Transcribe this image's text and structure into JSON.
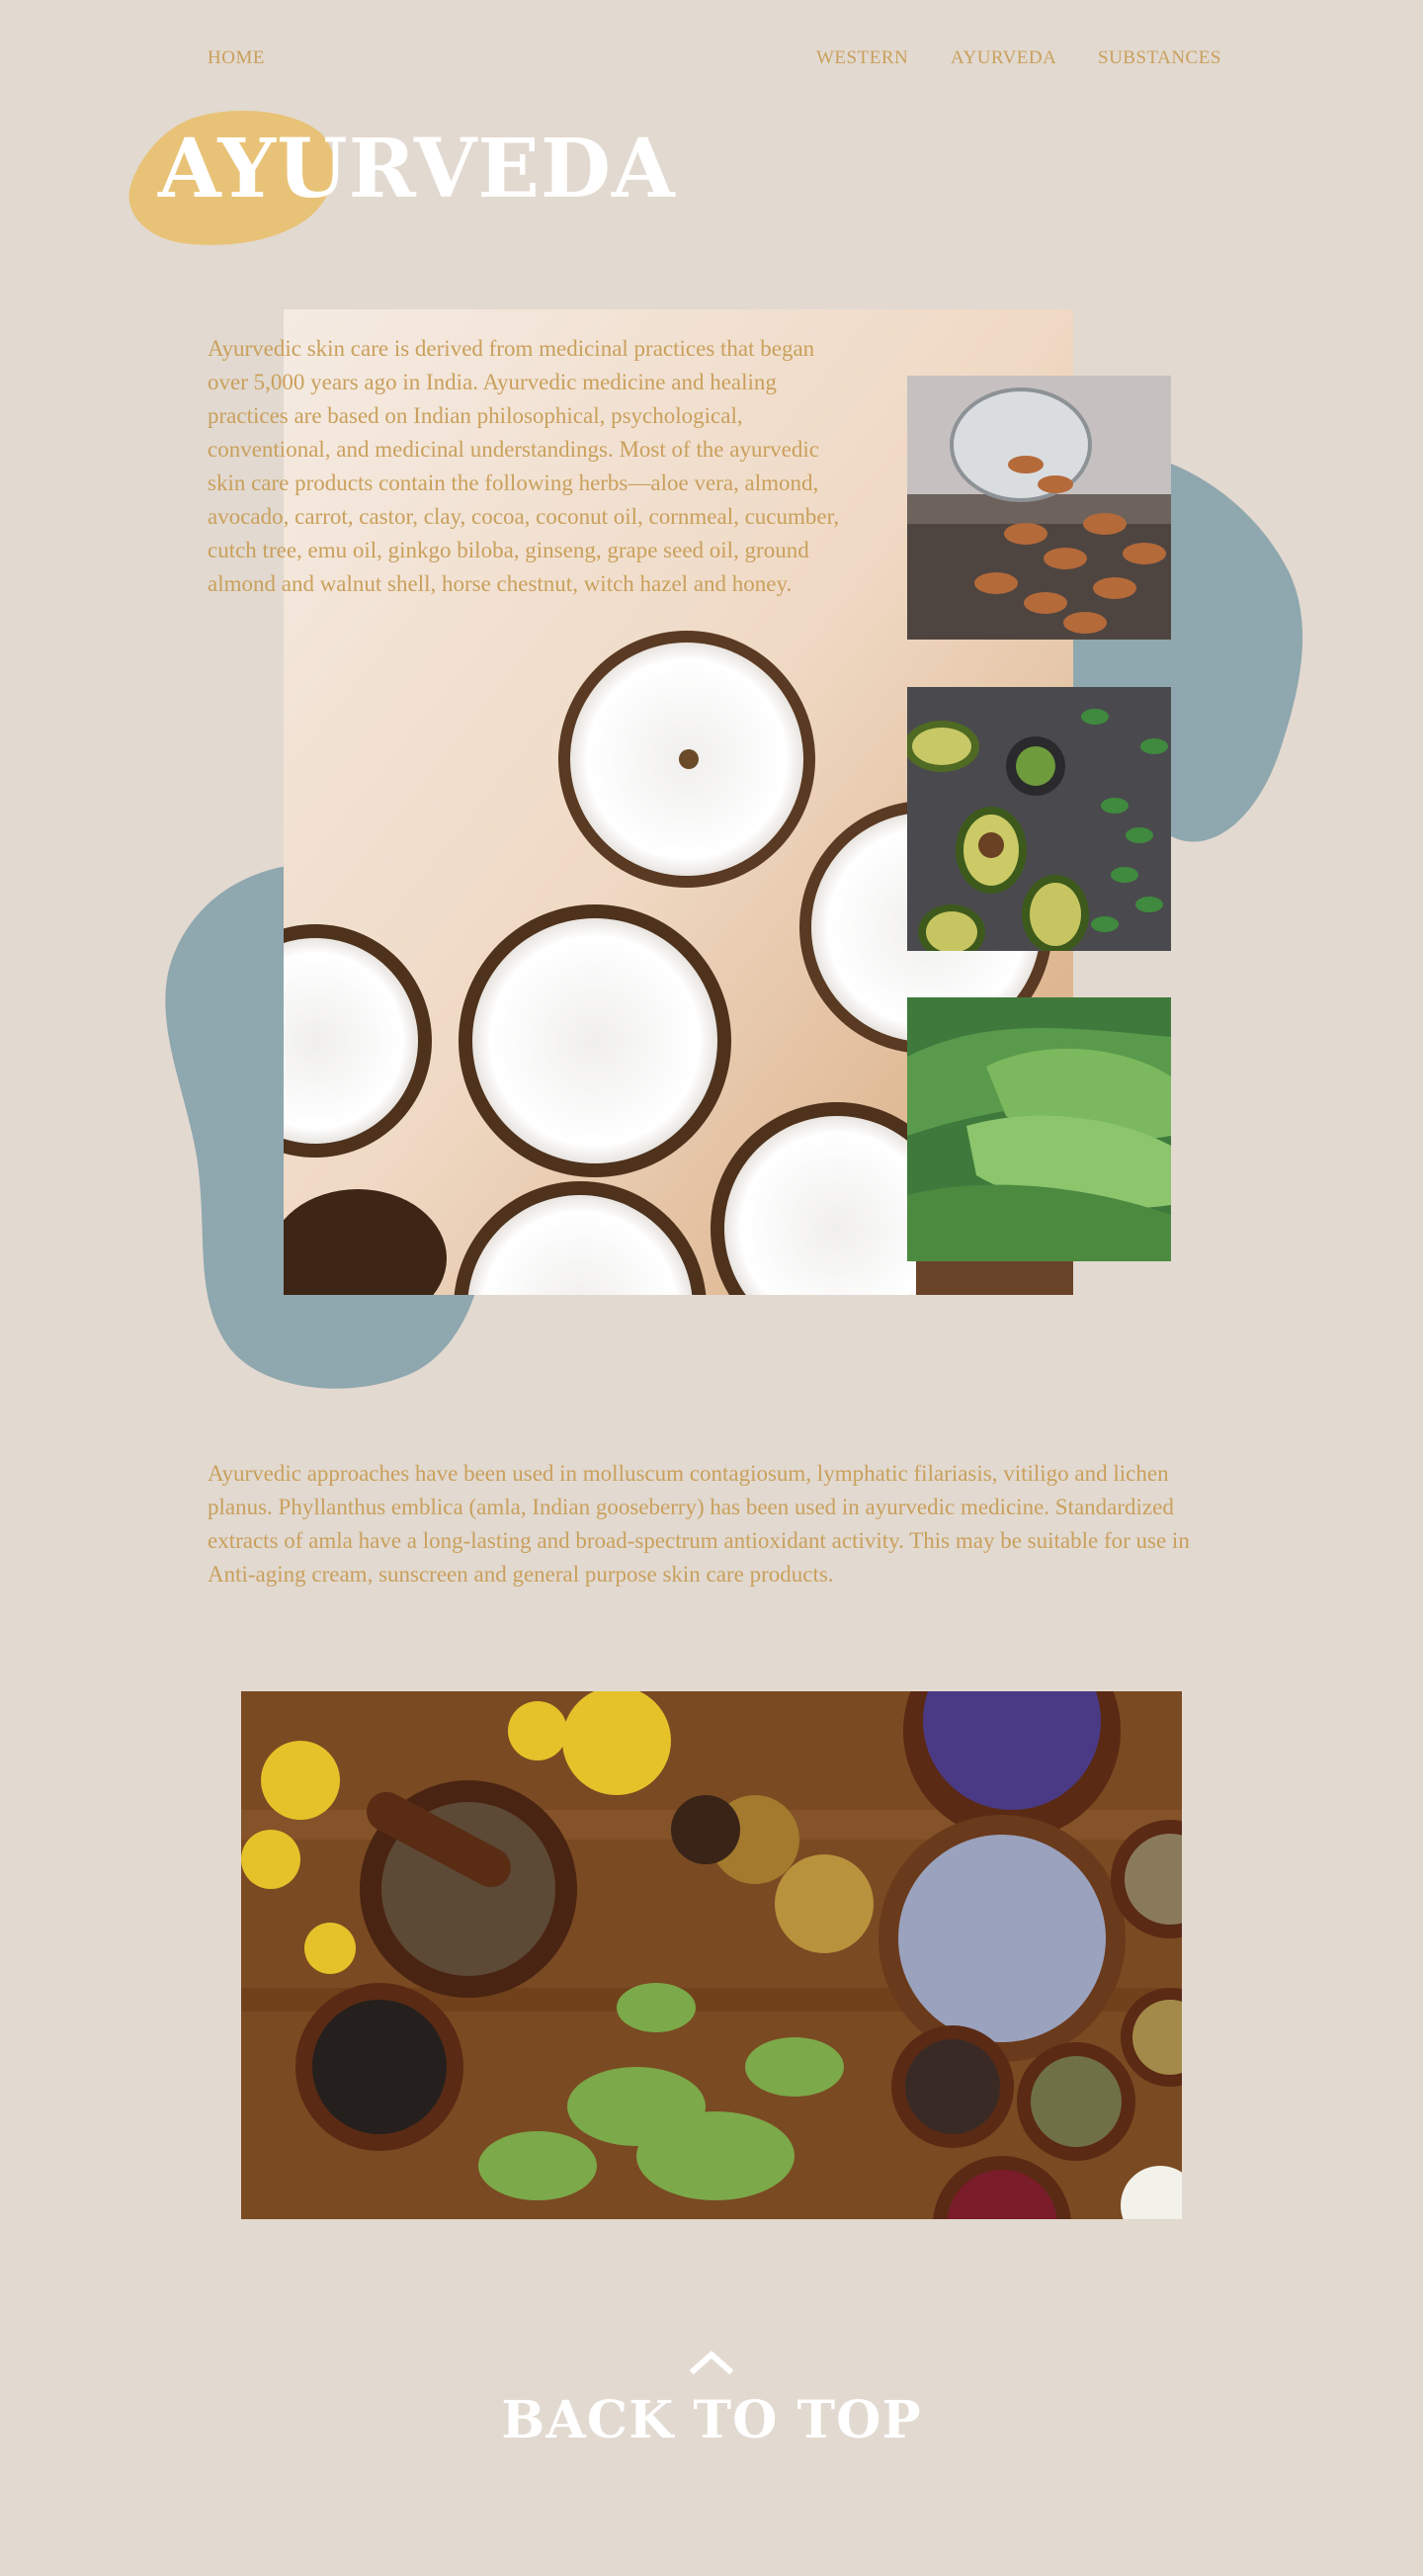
{
  "nav": {
    "home": "HOME",
    "western": "WESTERN",
    "ayurveda": "AYURVEDA",
    "substances": "SUBSTANCES"
  },
  "page_title": "AYURVEDA",
  "intro_text": "Ayurvedic skin care is derived from medicinal practices that began over 5,000 years ago in India. Ayurvedic medicine and healing practices are based on Indian philosophical, psychological, conventional, and medicinal understandings. Most of the ayurvedic skin care products contain the following herbs—aloe vera, almond, avocado, carrot, castor, clay, cocoa, coconut oil, cornmeal, cucumber, cutch tree, emu oil, ginkgo biloba, ginseng, grape seed oil, ground almond and walnut shell, horse chestnut, witch hazel and honey.",
  "second_text": "Ayurvedic approaches have been used in molluscum contagiosum, lymphatic filariasis, vitiligo and lichen planus. Phyllanthus emblica (amla, Indian gooseberry) has been used in ayurvedic medicine. Standardized extracts of amla have a long-lasting and broad-spectrum antioxidant activity. This may be suitable for use in Anti-aging cream, sunscreen and general purpose skin care products.",
  "back_to_top": "BACK TO TOP",
  "colors": {
    "background": "#e2d9d0",
    "accent_gold": "#c9a05c",
    "title_blob": "#e8c377",
    "teal_blob": "#8fa7ae"
  },
  "icons": {
    "back_to_top": "chevron-up-icon"
  }
}
